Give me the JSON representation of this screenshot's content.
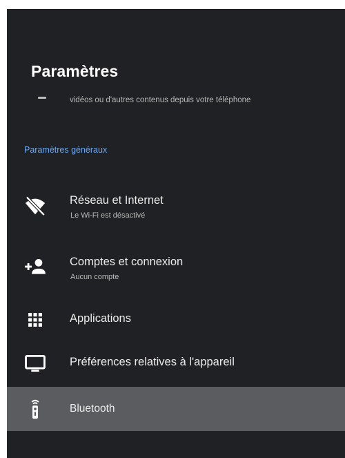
{
  "header": {
    "title": "Paramètres"
  },
  "scrolled_item": {
    "description": "vidéos ou d'autres contenus depuis votre téléphone"
  },
  "section": {
    "label": "Paramètres généraux"
  },
  "items": [
    {
      "label": "Réseau et Internet",
      "subtitle": "Le Wi-Fi est désactivé",
      "icon": "wifi-off-icon"
    },
    {
      "label": "Comptes et connexion",
      "subtitle": "Aucun compte",
      "icon": "add-account-icon"
    },
    {
      "label": "Applications",
      "icon": "apps-grid-icon"
    },
    {
      "label": "Préférences relatives à l'appareil",
      "icon": "tv-icon"
    },
    {
      "label": "Bluetooth",
      "icon": "remote-icon",
      "selected": true
    }
  ],
  "colors": {
    "background": "#202124",
    "selected_row": "#5a5c5f",
    "accent": "#6ea8f0",
    "text_primary": "#ececec",
    "text_secondary": "#b9b9b9"
  }
}
